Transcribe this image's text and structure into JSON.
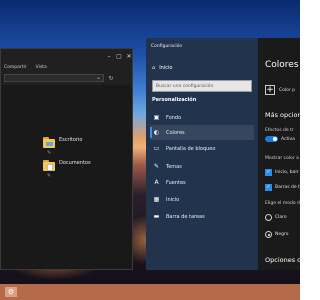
{
  "explorer": {
    "ribbon": [
      "Compartir",
      "Vista"
    ],
    "items": [
      {
        "label": "Escritorio",
        "icon": "folder-desktop-icon"
      },
      {
        "label": "Documentos",
        "icon": "folder-documents-icon"
      }
    ]
  },
  "settings": {
    "title": "Configuración",
    "home_label": "Inicio",
    "search_placeholder": "Buscar una configuración",
    "section_label": "Personalización",
    "nav_items": [
      {
        "label": "Fondo",
        "icon": "image-icon"
      },
      {
        "label": "Colores",
        "icon": "palette-icon",
        "active": true
      },
      {
        "label": "Pantalla de bloqueo",
        "icon": "lock-screen-icon"
      },
      {
        "label": "Temas",
        "icon": "brush-icon"
      },
      {
        "label": "Fuentes",
        "icon": "font-icon"
      },
      {
        "label": "Inicio",
        "icon": "start-icon"
      },
      {
        "label": "Barra de tareas",
        "icon": "taskbar-icon"
      }
    ],
    "content": {
      "title": "Colores",
      "custom_color_label": "Color p",
      "more_options": "Más opcion",
      "transparency_label": "Efectos de tr",
      "transparency_value": "Activa",
      "show_color_label": "Mostrar color a",
      "checkbox_start": "Inicio, barr",
      "checkbox_titlebars": "Barras de t",
      "mode_label": "Elige el modo d",
      "radio_light": "Claro",
      "radio_dark": "Negro",
      "radio_dark_selected": true,
      "contrast_label": "Opciones d"
    }
  },
  "colors": {
    "accent": "#2d8ee8",
    "nav_bg": "#22344e",
    "content_bg": "#1a1a1a",
    "taskbar": "#b56a4a"
  }
}
